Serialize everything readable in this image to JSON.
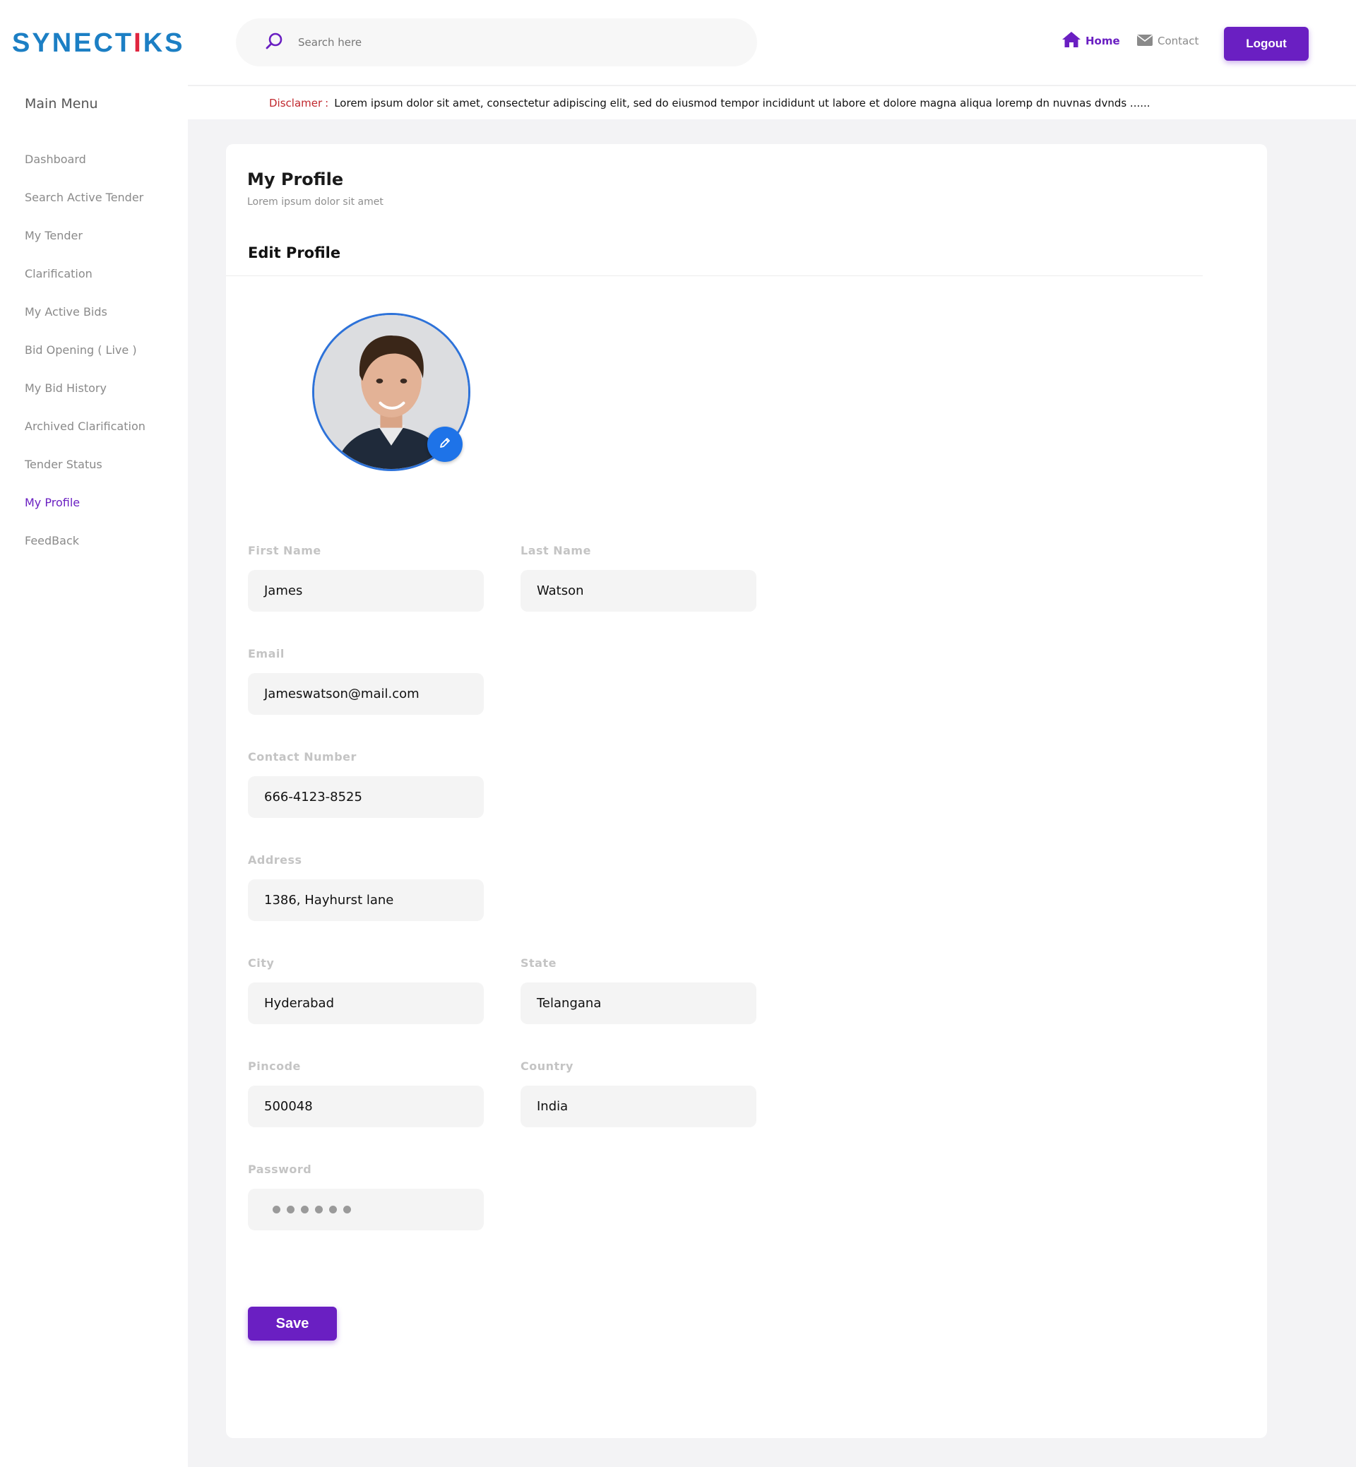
{
  "brand": {
    "logo_text_a": "SYNECT",
    "logo_text_i": "I",
    "logo_text_b": "KS"
  },
  "sidebar": {
    "title": "Main Menu",
    "items": [
      {
        "label": "Dashboard"
      },
      {
        "label": "Search Active Tender"
      },
      {
        "label": "My Tender"
      },
      {
        "label": "Clarification"
      },
      {
        "label": "My Active Bids"
      },
      {
        "label": "Bid Opening ( Live )"
      },
      {
        "label": "My Bid History"
      },
      {
        "label": "Archived Clarification"
      },
      {
        "label": "Tender Status"
      },
      {
        "label": "My Profile"
      },
      {
        "label": "FeedBack"
      }
    ],
    "active_index": 9
  },
  "header": {
    "search_placeholder": "Search here",
    "home_label": "Home",
    "contact_label": "Contact",
    "logout_label": "Logout"
  },
  "disclaimer": {
    "label": "Disclamer",
    "separator": ":",
    "text": "Lorem ipsum dolor sit amet, consectetur adipiscing elit, sed do eiusmod tempor incididunt ut labore et dolore magna aliqua loremp dn  nuvnas dvnds ......"
  },
  "profile": {
    "title": "My Profile",
    "subtitle": "Lorem ipsum dolor sit amet",
    "section_title": "Edit Profile",
    "fields": {
      "first_name": {
        "label": "First Name",
        "value": "James"
      },
      "last_name": {
        "label": "Last Name",
        "value": "Watson"
      },
      "email": {
        "label": "Email",
        "value": "Jameswatson@mail.com"
      },
      "contact": {
        "label": "Contact Number",
        "value": "666-4123-8525"
      },
      "address": {
        "label": "Address",
        "value": "1386, Hayhurst lane"
      },
      "city": {
        "label": "City",
        "value": "Hyderabad"
      },
      "state": {
        "label": "State",
        "value": "Telangana"
      },
      "pincode": {
        "label": "Pincode",
        "value": "500048"
      },
      "country": {
        "label": "Country",
        "value": "India"
      },
      "password": {
        "label": "Password",
        "masked_length": 6
      }
    },
    "save_label": "Save"
  },
  "colors": {
    "accent": "#6a1fc2",
    "brand_blue": "#1c7fc4",
    "brand_red": "#e0253f",
    "edit_badge": "#1e73e8",
    "disclaimer_label": "#c0272d"
  },
  "icons": {
    "search": "search-icon",
    "home": "home-icon",
    "contact": "envelope-icon",
    "edit": "pencil-icon"
  }
}
